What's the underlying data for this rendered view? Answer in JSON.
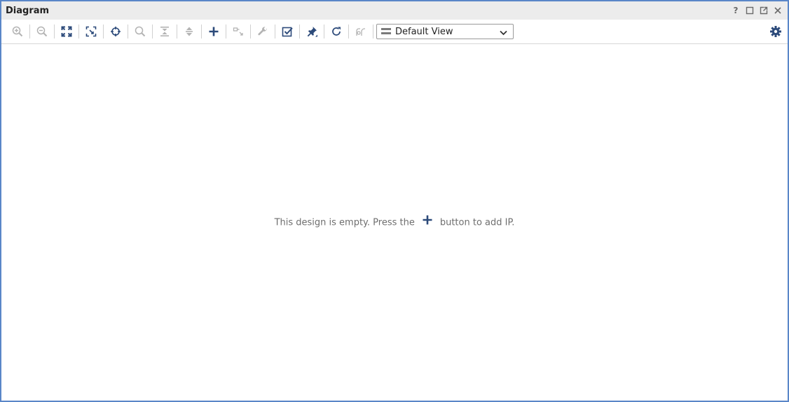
{
  "window": {
    "title": "Diagram",
    "controls": [
      "help-icon",
      "maximize-icon",
      "float-icon",
      "close-icon"
    ],
    "help_label": "?"
  },
  "toolbar": {
    "buttons": [
      {
        "name": "zoom-in-icon",
        "enabled": false
      },
      {
        "name": "zoom-out-icon",
        "enabled": false
      },
      {
        "name": "zoom-fit-icon",
        "enabled": true
      },
      {
        "name": "zoom-area-icon",
        "enabled": true
      },
      {
        "name": "center-icon",
        "enabled": true
      },
      {
        "name": "search-icon",
        "enabled": false
      },
      {
        "name": "collapse-all-icon",
        "enabled": false
      },
      {
        "name": "expand-all-icon",
        "enabled": false
      },
      {
        "name": "add-ip-icon",
        "enabled": true
      },
      {
        "name": "make-external-icon",
        "enabled": false
      },
      {
        "name": "wrench-icon",
        "enabled": false
      },
      {
        "name": "validate-icon",
        "enabled": true
      },
      {
        "name": "autoconnect-pin-icon",
        "enabled": true
      },
      {
        "name": "regenerate-layout-icon",
        "enabled": true
      },
      {
        "name": "optimize-routing-icon",
        "enabled": false
      }
    ],
    "view_select": {
      "value": "Default View",
      "icon": "view-layout-icon"
    },
    "settings_icon": "gear-icon"
  },
  "canvas": {
    "empty_text_before": "This design is empty. Press the",
    "empty_text_after": "button to add IP.",
    "inline_icon": "add-ip-icon"
  },
  "colors": {
    "active_icon": "#2c4a7a",
    "disabled_icon": "#b3b3b3",
    "border": "#5a86c8",
    "titlebar_bg": "#ececec"
  }
}
